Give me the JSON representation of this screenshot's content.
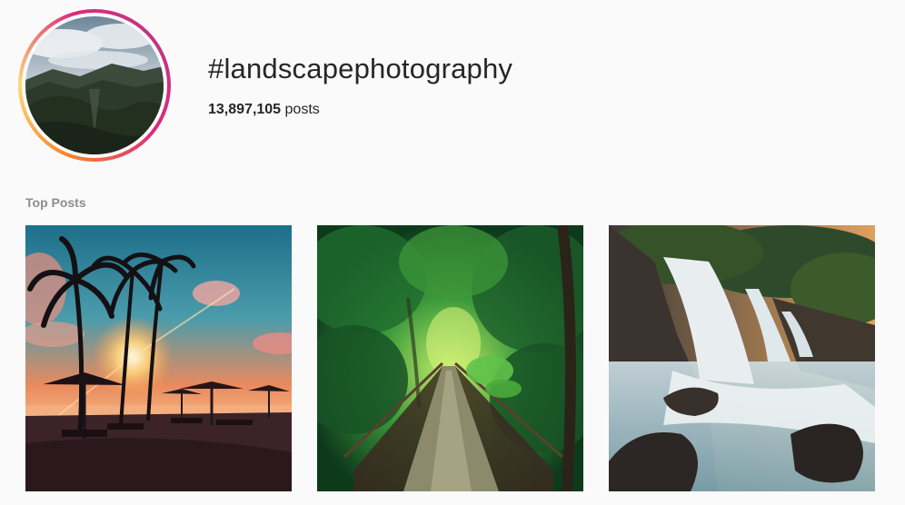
{
  "header": {
    "hashtag": "#landscapephotography",
    "post_count": "13,897,105",
    "post_count_suffix": "posts"
  },
  "top_posts": {
    "label": "Top Posts"
  }
}
